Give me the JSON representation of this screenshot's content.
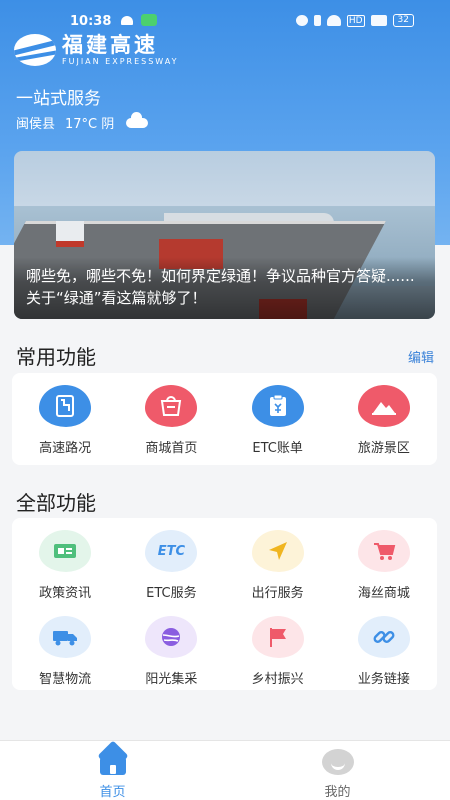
{
  "status_bar": {
    "time": "10:38",
    "battery": "32",
    "hd": "HD"
  },
  "header": {
    "logo_cn": "福建高速",
    "logo_en": "FUJIAN EXPRESSWAY",
    "subtitle": "一站式服务",
    "location": "闽侯县",
    "weather": "17°C 阴"
  },
  "banner": {
    "caption": "哪些免，哪些不免！如何界定绿通！争议品种官方答疑......关于“绿通”看这篇就够了！"
  },
  "common": {
    "title": "常用功能",
    "edit_label": "编辑",
    "items": [
      {
        "label": "高速路况",
        "icon": "road-map-icon",
        "color": "#3d8fe6"
      },
      {
        "label": "商城首页",
        "icon": "shop-icon",
        "color": "#ef5a6a"
      },
      {
        "label": "ETC账单",
        "icon": "bill-icon",
        "color": "#3d8fe6"
      },
      {
        "label": "旅游景区",
        "icon": "mountain-icon",
        "color": "#ef5a6a"
      }
    ]
  },
  "all": {
    "title": "全部功能",
    "items": [
      {
        "label": "政策资讯",
        "icon": "news-card-icon",
        "color": "#4fbf7c",
        "bg": "#e3f5ea"
      },
      {
        "label": "ETC服务",
        "icon": "etc-icon",
        "color": "#3d8fe6",
        "bg": "#e2eefb",
        "glyph": "ETC"
      },
      {
        "label": "出行服务",
        "icon": "navigation-arrow-icon",
        "color": "#f0b520",
        "bg": "#fdf3d8"
      },
      {
        "label": "海丝商城",
        "icon": "cart-icon",
        "color": "#ef5a6a",
        "bg": "#fde5e8"
      },
      {
        "label": "智慧物流",
        "icon": "truck-icon",
        "color": "#3d8fe6",
        "bg": "#e2eefb"
      },
      {
        "label": "阳光集采",
        "icon": "ball-icon",
        "color": "#8a5ee0",
        "bg": "#eee6fb"
      },
      {
        "label": "乡村振兴",
        "icon": "flag-icon",
        "color": "#ef5a6a",
        "bg": "#fde5e8"
      },
      {
        "label": "业务链接",
        "icon": "link-icon",
        "color": "#3d8fe6",
        "bg": "#e2eefb"
      }
    ]
  },
  "nav": {
    "items": [
      {
        "label": "首页",
        "color": "#3d8fe6"
      },
      {
        "label": "我的",
        "color": "#666666"
      }
    ]
  }
}
